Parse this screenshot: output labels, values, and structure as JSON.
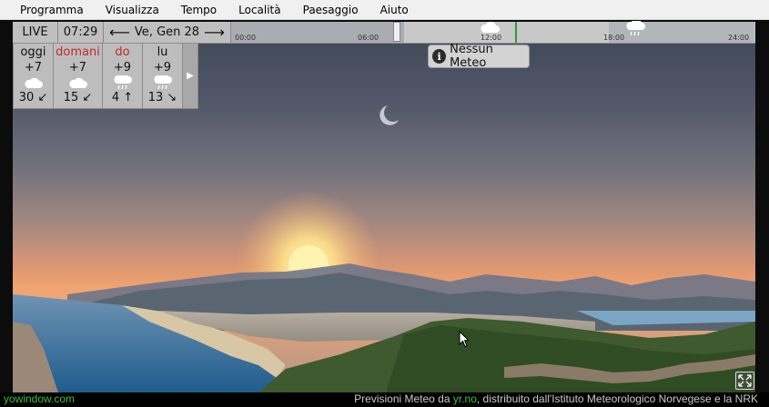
{
  "menu": [
    "Programma",
    "Visualizza",
    "Tempo",
    "Località",
    "Paesaggio",
    "Aiuto"
  ],
  "topbar": {
    "live_label": "LIVE",
    "time": "07:29",
    "date": "Ve, Gen 28",
    "prev_arrow": "⟵",
    "next_arrow": "⟶"
  },
  "timeline": {
    "ticks": [
      "00:00",
      "06:00",
      "12:00",
      "18:00",
      "24:00"
    ],
    "now_label": "07:29",
    "icons": [
      "cloud-icon",
      "cloud-rain-icon"
    ]
  },
  "forecast": [
    {
      "name": "oggi",
      "temp": "+7",
      "icon": "cloud-icon",
      "wind": "30 ↙",
      "highlight": false
    },
    {
      "name": "domani",
      "temp": "+7",
      "icon": "cloud-icon",
      "wind": "15 ↙",
      "highlight": true
    },
    {
      "name": "do",
      "temp": "+9",
      "icon": "cloud-rain-icon",
      "wind": "4 ↑",
      "highlight": true
    },
    {
      "name": "lu",
      "temp": "+9",
      "icon": "cloud-rain-icon",
      "wind": "13 ↘",
      "highlight": false
    }
  ],
  "forecast_next": "▶",
  "no_weather": {
    "icon": "i",
    "label": "Nessun Meteo"
  },
  "footer": {
    "brand": "yowindow.com",
    "credit_prefix": "Previsioni Meteo da",
    "credit_link": "yr.no",
    "credit_suffix": ", distribuito dall'Istituto Meteorologico Norvegese e la NRK"
  },
  "colors": {
    "accent_green": "#3bbf3b",
    "highlight_red": "#c62828",
    "panel_gray": "#bfbfbf"
  }
}
